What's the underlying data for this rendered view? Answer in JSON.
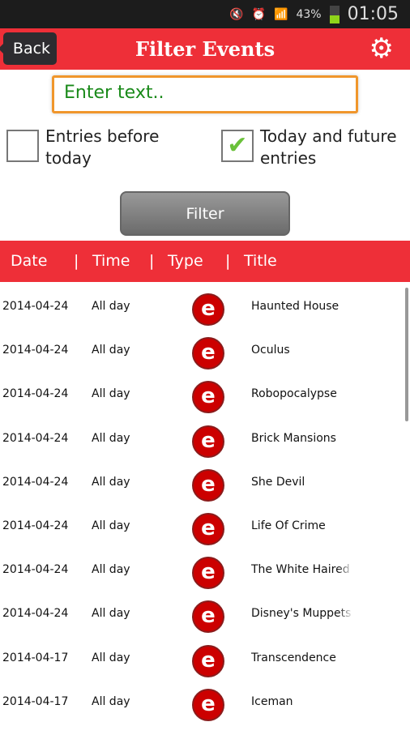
{
  "status": {
    "battery": "43%",
    "time": "01:05"
  },
  "appbar": {
    "back": "Back",
    "title": "Filter Events"
  },
  "search": {
    "placeholder": "Enter text.."
  },
  "filters": {
    "before": {
      "label": "Entries before today",
      "checked": false
    },
    "future": {
      "label": "Today and future entries",
      "checked": true
    }
  },
  "filter_button": "Filter",
  "columns": [
    "Date",
    "|",
    "Time",
    "|",
    "Type",
    "|",
    "Title"
  ],
  "rows": [
    {
      "date": "2014-04-24",
      "time": "All day",
      "type": "e",
      "title": "Haunted House"
    },
    {
      "date": "2014-04-24",
      "time": "All day",
      "type": "e",
      "title": "Oculus"
    },
    {
      "date": "2014-04-24",
      "time": "All day",
      "type": "e",
      "title": "Robopocalypse"
    },
    {
      "date": "2014-04-24",
      "time": "All day",
      "type": "e",
      "title": "Brick Mansions"
    },
    {
      "date": "2014-04-24",
      "time": "All day",
      "type": "e",
      "title": "She Devil"
    },
    {
      "date": "2014-04-24",
      "time": "All day",
      "type": "e",
      "title": "Life Of Crime"
    },
    {
      "date": "2014-04-24",
      "time": "All day",
      "type": "e",
      "title": "The White Haired W"
    },
    {
      "date": "2014-04-24",
      "time": "All day",
      "type": "e",
      "title": "Disney's Muppets M"
    },
    {
      "date": "2014-04-17",
      "time": "All day",
      "type": "e",
      "title": "Transcendence"
    },
    {
      "date": "2014-04-17",
      "time": "All day",
      "type": "e",
      "title": "Iceman"
    }
  ],
  "colors": {
    "accent": "#ee2f38",
    "input_border": "#f0962c",
    "placeholder": "#1a8a1a"
  }
}
